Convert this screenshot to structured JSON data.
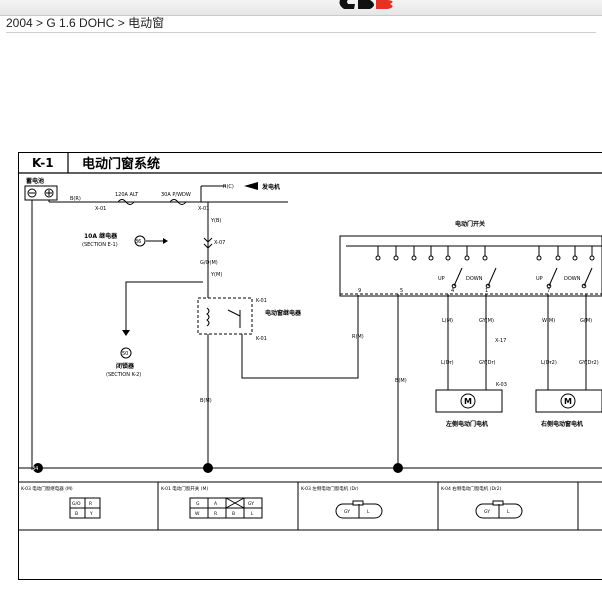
{
  "header": {
    "breadcrumb": "2004 > G 1.6 DOHC > 电动窗"
  },
  "diagram": {
    "code": "K-1",
    "title": "电动门窗系统",
    "battery_label": "蓄电池",
    "generator_label": "发电机",
    "relay_label": "10A 继电器",
    "relay_ref": "(SECTION E-1)",
    "window_relay_label": "电动窗继电器",
    "ignition_label": "闭锁器",
    "ignition_ref": "(SECTION K-2)",
    "switch_label": "电动门开关",
    "left_motor_label": "左侧电动门电机",
    "right_motor_label": "右侧电动窗电机",
    "fuse1": "120A ALT",
    "fuse2": "30A P/WDW",
    "wire_b_r": "B(R)",
    "wire_r_c": "R(C)",
    "wire_y_b": "Y(B)",
    "wire_y_m": "Y(M)",
    "wire_g_om": "G/O(M)",
    "wire_r_m": "R(M)",
    "wire_b_m": "B(M)",
    "wire_b_m2": "B(M)",
    "conn_x01a": "X-01",
    "conn_x01b": "X-01",
    "conn_x07": "X-07",
    "conn_k01a": "K-01",
    "conn_k01b": "K-01",
    "conn_x17": "X-17",
    "conn_k03": "K-03",
    "ground_34": "34",
    "badge_36": "36",
    "badge_50": "50",
    "up_label": "UP",
    "down_label": "DOWN",
    "wire_l_m": "L(M)",
    "wire_gy_m": "GY(M)",
    "wire_w_m": "W(M)",
    "wire_g_m": "G(M)",
    "wire_l_dr": "L(Dr)",
    "wire_gy_dr": "GY(Dr)",
    "wire_l_dr2": "L(Dr2)",
    "wire_gy_dr2": "GY(Dr2)",
    "pin_9": "9",
    "pin_5": "5",
    "pin_4": "4",
    "pin_1": "1",
    "pin_7": "7",
    "motor_symbol": "M",
    "connectors": [
      {
        "caption": "K-03 电动门窗继电器 (M)",
        "cells": [
          "G/O",
          "R",
          "B",
          "Y"
        ]
      },
      {
        "caption": "K-01 电动门窗开关 (M)",
        "cells": [
          "G",
          "A",
          "",
          "GY",
          "W",
          "R",
          "B",
          "L"
        ]
      },
      {
        "caption": "K-03 左侧电动门窗电机 (Dr)",
        "cells": [
          "GY",
          "L"
        ]
      },
      {
        "caption": "K-04 右侧电动门窗电机 (Dr2)",
        "cells": [
          "GY",
          "L"
        ]
      }
    ]
  }
}
